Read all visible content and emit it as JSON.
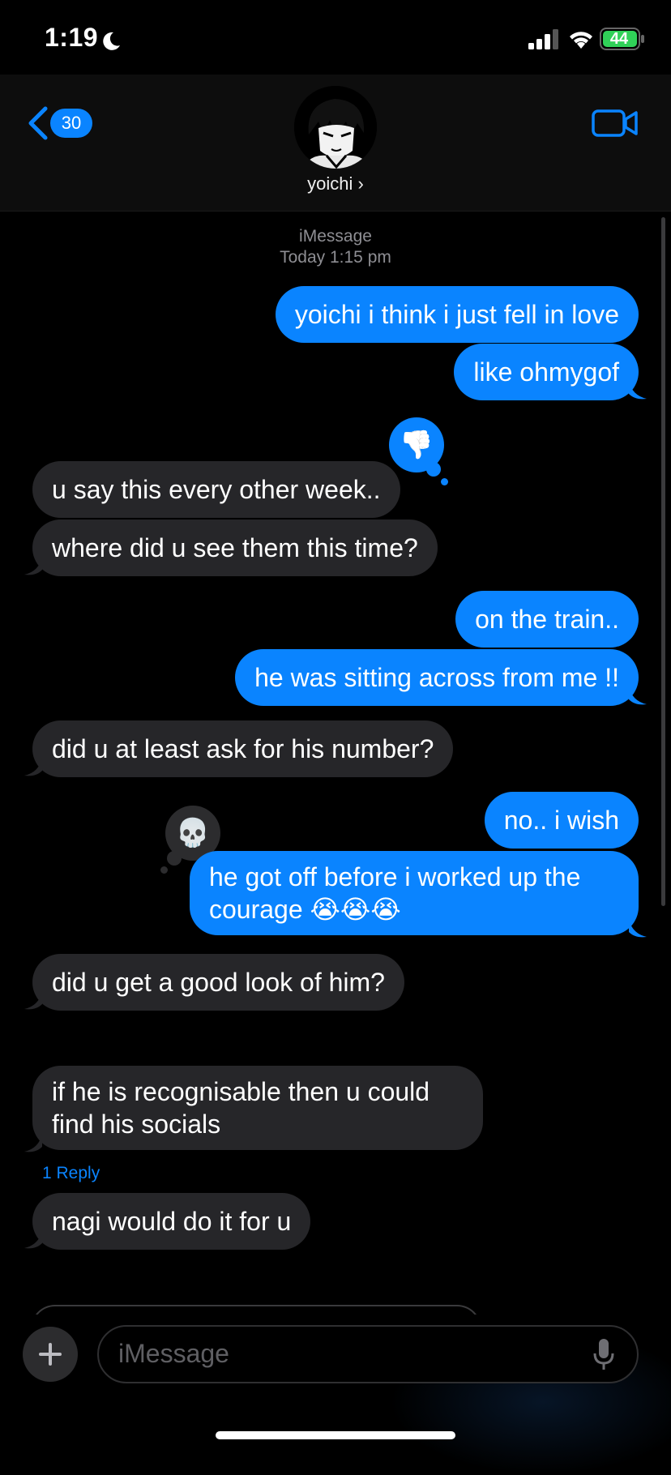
{
  "status_bar": {
    "time": "1:19",
    "battery": "44"
  },
  "header": {
    "back_count": "30",
    "contact_name": "yoichi ›"
  },
  "thread_meta": {
    "service": "iMessage",
    "timestamp": "Today 1:15 pm"
  },
  "messages": [
    {
      "dir": "out",
      "text": "yoichi i think i just fell in love"
    },
    {
      "dir": "out",
      "text": "like ohmygof"
    },
    {
      "dir": "in",
      "text": "u say this every other week.."
    },
    {
      "dir": "in",
      "text": "where did u see them this time?"
    },
    {
      "dir": "out",
      "text": "on the train.."
    },
    {
      "dir": "out",
      "text": "he was sitting across from me !!"
    },
    {
      "dir": "in",
      "text": "did u at least ask for his number?"
    },
    {
      "dir": "out",
      "text": "no.. i wish"
    },
    {
      "dir": "out",
      "line1": "he got off before i worked up the",
      "line2": "courage 😭😭😭"
    },
    {
      "dir": "in",
      "text": "did u get a good look of him?"
    },
    {
      "dir": "in",
      "line1": "if he is recognisable then u could",
      "line2": "find his socials"
    },
    {
      "dir": "in",
      "text": "nagi would do it for u"
    }
  ],
  "reactions": {
    "thumbs_down": {
      "icon": "thumbs-down-icon",
      "emoji": "👎"
    },
    "skull": {
      "icon": "skull-icon",
      "emoji": "💀"
    }
  },
  "reply_link": "1 Reply",
  "composer": {
    "placeholder": "iMessage"
  },
  "colors": {
    "outgoing": "#0a84ff",
    "incoming": "#262629",
    "accent": "#0a84ff",
    "background": "#000000"
  }
}
